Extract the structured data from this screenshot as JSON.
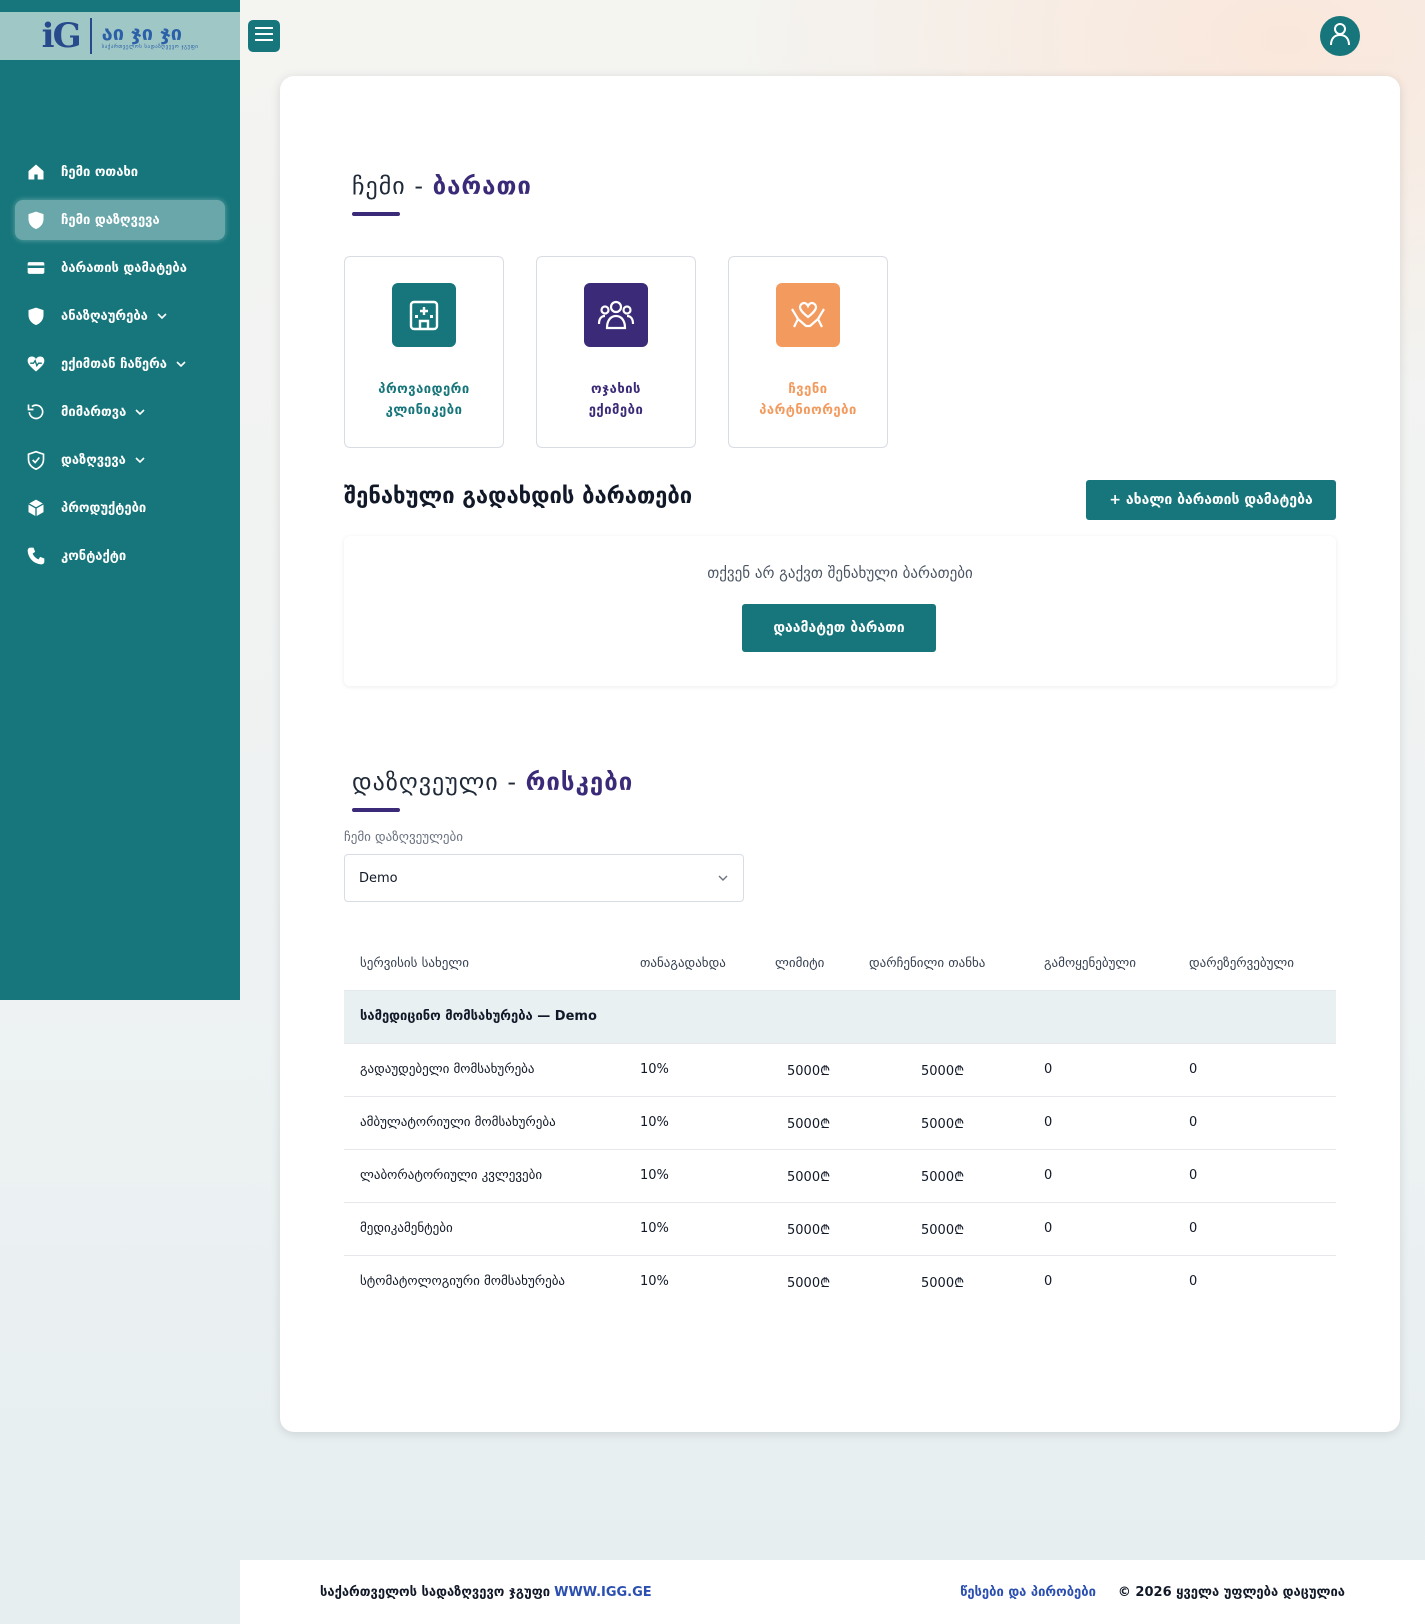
{
  "brand": {
    "logo_mark": "iG",
    "logo_text": "აი ჯი ჯი",
    "logo_subtitle": "საქართველოს სადაზღვევო ჯგუფი"
  },
  "sidebar": {
    "items": [
      {
        "label": "ჩემი ოთახი",
        "icon": "home-icon"
      },
      {
        "label": "ჩემი დაზღვევა",
        "icon": "shield-icon",
        "active": true
      },
      {
        "label": "ბარათის დამატება",
        "icon": "card-icon"
      },
      {
        "label": "ანაზღაურება",
        "icon": "shield-icon",
        "has_children": true
      },
      {
        "label": "ექიმთან ჩაწერა",
        "icon": "heartbeat-icon",
        "has_children": true
      },
      {
        "label": "მიმართვა",
        "icon": "rotate-icon",
        "has_children": true
      },
      {
        "label": "დაზღვევა",
        "icon": "shield-check-icon",
        "has_children": true
      },
      {
        "label": "პროდუქტები",
        "icon": "box-icon"
      },
      {
        "label": "კონტაქტი",
        "icon": "phone-icon"
      }
    ]
  },
  "section1": {
    "title_part1": "ჩემი - ",
    "title_part2": "ბარათი"
  },
  "tiles": [
    {
      "label": "პროვაიდერი\nკლინიკები",
      "icon": "hospital-icon",
      "color": "#16767b"
    },
    {
      "label": "ოჯახის\nექიმები",
      "icon": "family-icon",
      "color": "#3b2a78"
    },
    {
      "label": "ჩვენი\nპარტნიორები",
      "icon": "partners-icon",
      "color": "#f39a5e"
    }
  ],
  "cards": {
    "title": "შენახული გადახდის ბარათები",
    "add_button": "+ ახალი ბარათის დამატება",
    "empty_text": "თქვენ არ გაქვთ შენახული ბარათები",
    "empty_button": "დაამატეთ ბარათი"
  },
  "section2": {
    "title_part1": "დაზღვეული - ",
    "title_part2": "რისკები",
    "select_label": "ჩემი დაზღვეულები",
    "select_value": "Demo"
  },
  "table": {
    "headers": [
      "სერვისის სახელი",
      "თანაგადახდა",
      "ლიმიტი",
      "დარჩენილი თანხა",
      "გამოყენებული",
      "დარეზერვებული"
    ],
    "group": "სამედიცინო მომსახურება — Demo",
    "rows": [
      [
        "გადაუდებელი მომსახურება",
        "10%",
        "5000₾",
        "5000₾",
        "0",
        "0"
      ],
      [
        "ამბულატორიული მომსახურება",
        "10%",
        "5000₾",
        "5000₾",
        "0",
        "0"
      ],
      [
        "ლაბორატორიული კვლევები",
        "10%",
        "5000₾",
        "5000₾",
        "0",
        "0"
      ],
      [
        "მედიკამენტები",
        "10%",
        "5000₾",
        "5000₾",
        "0",
        "0"
      ],
      [
        "სტომატოლოგიური მომსახურება",
        "10%",
        "5000₾",
        "5000₾",
        "0",
        "0"
      ]
    ]
  },
  "footer": {
    "company": "საქართველოს სადაზღვევო ჯგუფი",
    "link": "WWW.IGG.GE",
    "terms": "წესები და პირობები",
    "copyright": "© 2026 ყველა უფლება დაცულია"
  },
  "colors": {
    "primary": "#16767b",
    "accent": "#3b2a78",
    "orange": "#f39a5e"
  }
}
